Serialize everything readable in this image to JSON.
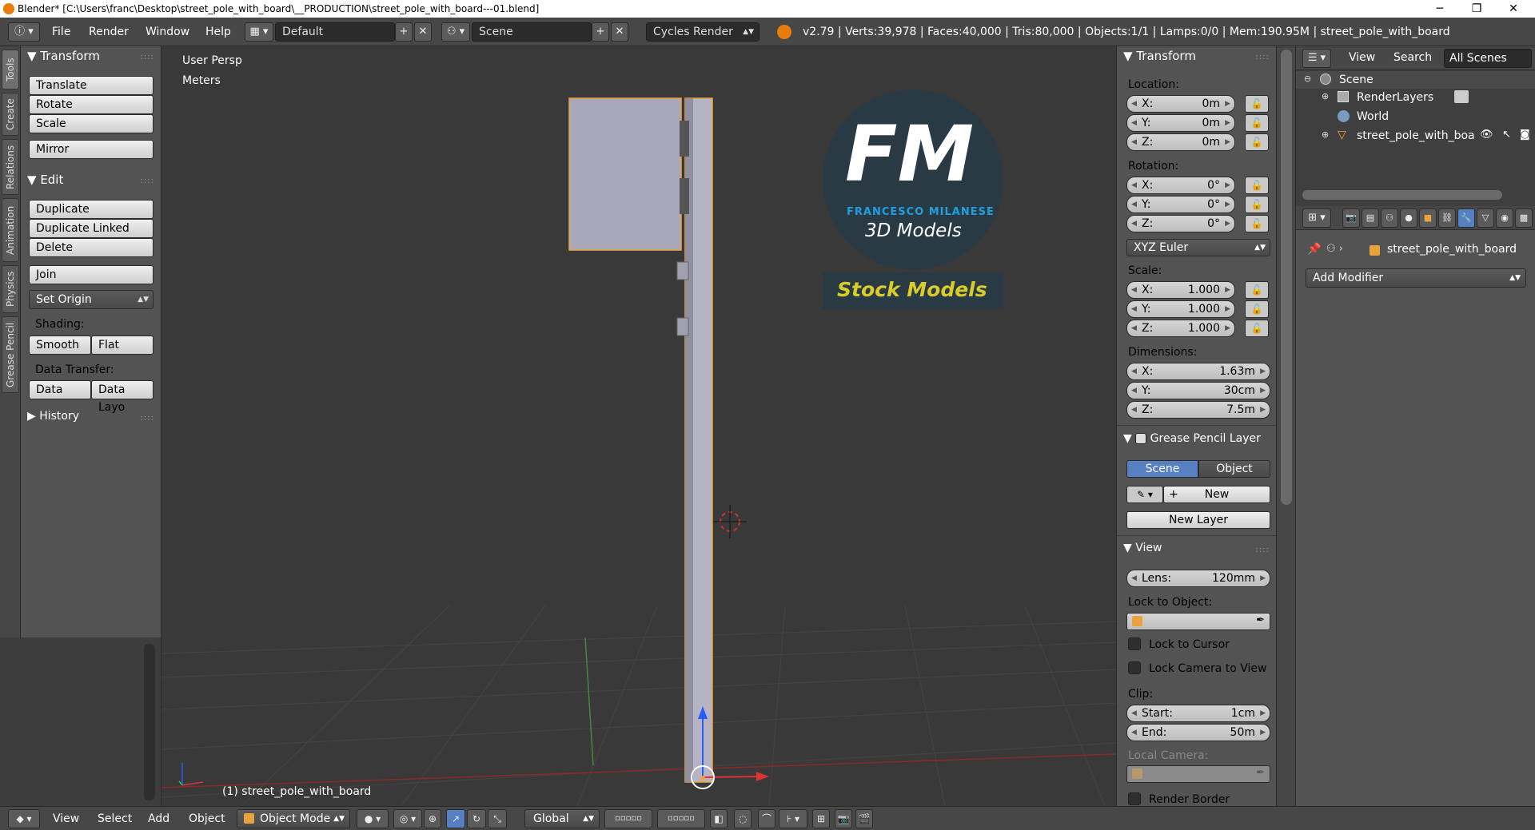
{
  "window": {
    "title": "Blender* [C:\\Users\\franc\\Desktop\\street_pole_with_board\\__PRODUCTION\\street_pole_with_board---01.blend]",
    "minimize": "─",
    "maximize": "❐",
    "close": "✕"
  },
  "topbar": {
    "menus": [
      "File",
      "Render",
      "Window",
      "Help"
    ],
    "layout": "Default",
    "scene": "Scene",
    "engine": "Cycles Render",
    "stats": "v2.79 | Verts:39,978 | Faces:40,000 | Tris:80,000 | Objects:1/1 | Lamps:0/0 | Mem:190.95M | street_pole_with_board"
  },
  "left_tabs": [
    "Tools",
    "Create",
    "Relations",
    "Animation",
    "Physics",
    "Grease Pencil"
  ],
  "toolshelf": {
    "transform_header": "Transform",
    "translate": "Translate",
    "rotate": "Rotate",
    "scale": "Scale",
    "mirror": "Mirror",
    "edit_header": "Edit",
    "duplicate": "Duplicate",
    "duplicate_linked": "Duplicate Linked",
    "delete": "Delete",
    "join": "Join",
    "set_origin": "Set Origin",
    "shading_label": "Shading:",
    "smooth": "Smooth",
    "flat": "Flat",
    "data_transfer_label": "Data Transfer:",
    "data": "Data",
    "data_layout": "Data Layo",
    "history_header": "History"
  },
  "viewport": {
    "view_name": "User Persp",
    "units": "Meters",
    "object_label": "(1) street_pole_with_board",
    "logo_initials": "FM",
    "logo_name": "FRANCESCO MILANESE",
    "logo_sub": "3D Models",
    "logo_banner": "Stock Models"
  },
  "npanel": {
    "transform_header": "Transform",
    "location_label": "Location:",
    "loc_x_key": "X:",
    "loc_x": "0m",
    "loc_y_key": "Y:",
    "loc_y": "0m",
    "loc_z_key": "Z:",
    "loc_z": "0m",
    "rotation_label": "Rotation:",
    "rot_x_key": "X:",
    "rot_x": "0°",
    "rot_y_key": "Y:",
    "rot_y": "0°",
    "rot_z_key": "Z:",
    "rot_z": "0°",
    "rotation_mode": "XYZ Euler",
    "scale_label": "Scale:",
    "scale_x_key": "X:",
    "scale_x": "1.000",
    "scale_y_key": "Y:",
    "scale_y": "1.000",
    "scale_z_key": "Z:",
    "scale_z": "1.000",
    "dimensions_label": "Dimensions:",
    "dim_x_key": "X:",
    "dim_x": "1.63m",
    "dim_y_key": "Y:",
    "dim_y": "30cm",
    "dim_z_key": "Z:",
    "dim_z": "7.5m",
    "grease_header": "Grease Pencil Layer",
    "gp_scene": "Scene",
    "gp_object": "Object",
    "gp_new": "New",
    "gp_new_layer": "New Layer",
    "view_header": "View",
    "lens_key": "Lens:",
    "lens": "120mm",
    "lock_object_label": "Lock to Object:",
    "lock_cursor": "Lock to Cursor",
    "lock_camera": "Lock Camera to View",
    "clip_label": "Clip:",
    "clip_start_key": "Start:",
    "clip_start": "1cm",
    "clip_end_key": "End:",
    "clip_end": "50m",
    "local_camera_label": "Local Camera:",
    "render_border": "Render Border"
  },
  "outliner": {
    "view": "View",
    "search": "Search",
    "filter": "All Scenes",
    "scene": "Scene",
    "render_layers": "RenderLayers",
    "world": "World",
    "object": "street_pole_with_board"
  },
  "properties": {
    "object_name": "street_pole_with_board",
    "add_modifier": "Add Modifier"
  },
  "bottombar": {
    "view": "View",
    "select": "Select",
    "add": "Add",
    "object": "Object",
    "mode": "Object Mode",
    "orientation": "Global"
  },
  "colors": {
    "accent_blue": "#1e9fe0",
    "selection_orange": "#f1a33c",
    "banner_yellow": "#d9cc2a",
    "active_blue": "#5680c2"
  }
}
